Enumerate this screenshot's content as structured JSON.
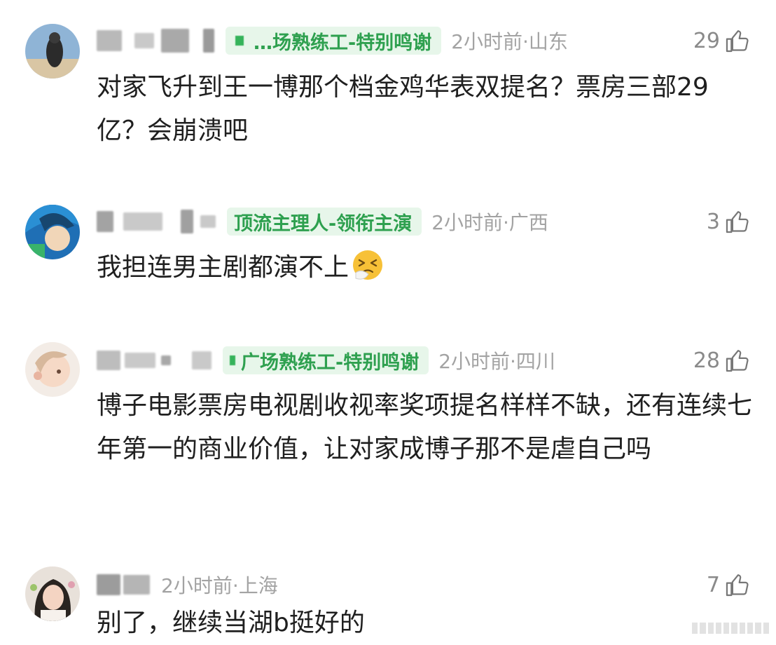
{
  "comments": [
    {
      "badge": "…场熟练工-特别鸣谢",
      "time": "2小时前·山东",
      "likes": "29",
      "text": "对家飞升到王一博那个档金鸡华表双提名？票房三部29亿？会崩溃吧"
    },
    {
      "badge": "顶流主理人-领衔主演",
      "time": "2小时前·广西",
      "likes": "3",
      "text": "我担连男主剧都演不上",
      "emoji": "sneezing-face"
    },
    {
      "badge": "广场熟练工-特别鸣谢",
      "time": "2小时前·四川",
      "likes": "28",
      "text": "博子电影票房电视剧收视率奖项提名样样不缺，还有连续七年第一的商业价值，让对家成博子那不是虐自己吗"
    },
    {
      "time": "2小时前·上海",
      "likes": "7",
      "text": "别了，继续当湖b挺好的"
    }
  ],
  "icons": {
    "like": "thumbs-up-outline-icon"
  },
  "colors": {
    "badge_bg": "#e7f6ea",
    "badge_text": "#2ea04f",
    "meta_text": "#a3a3a3"
  }
}
